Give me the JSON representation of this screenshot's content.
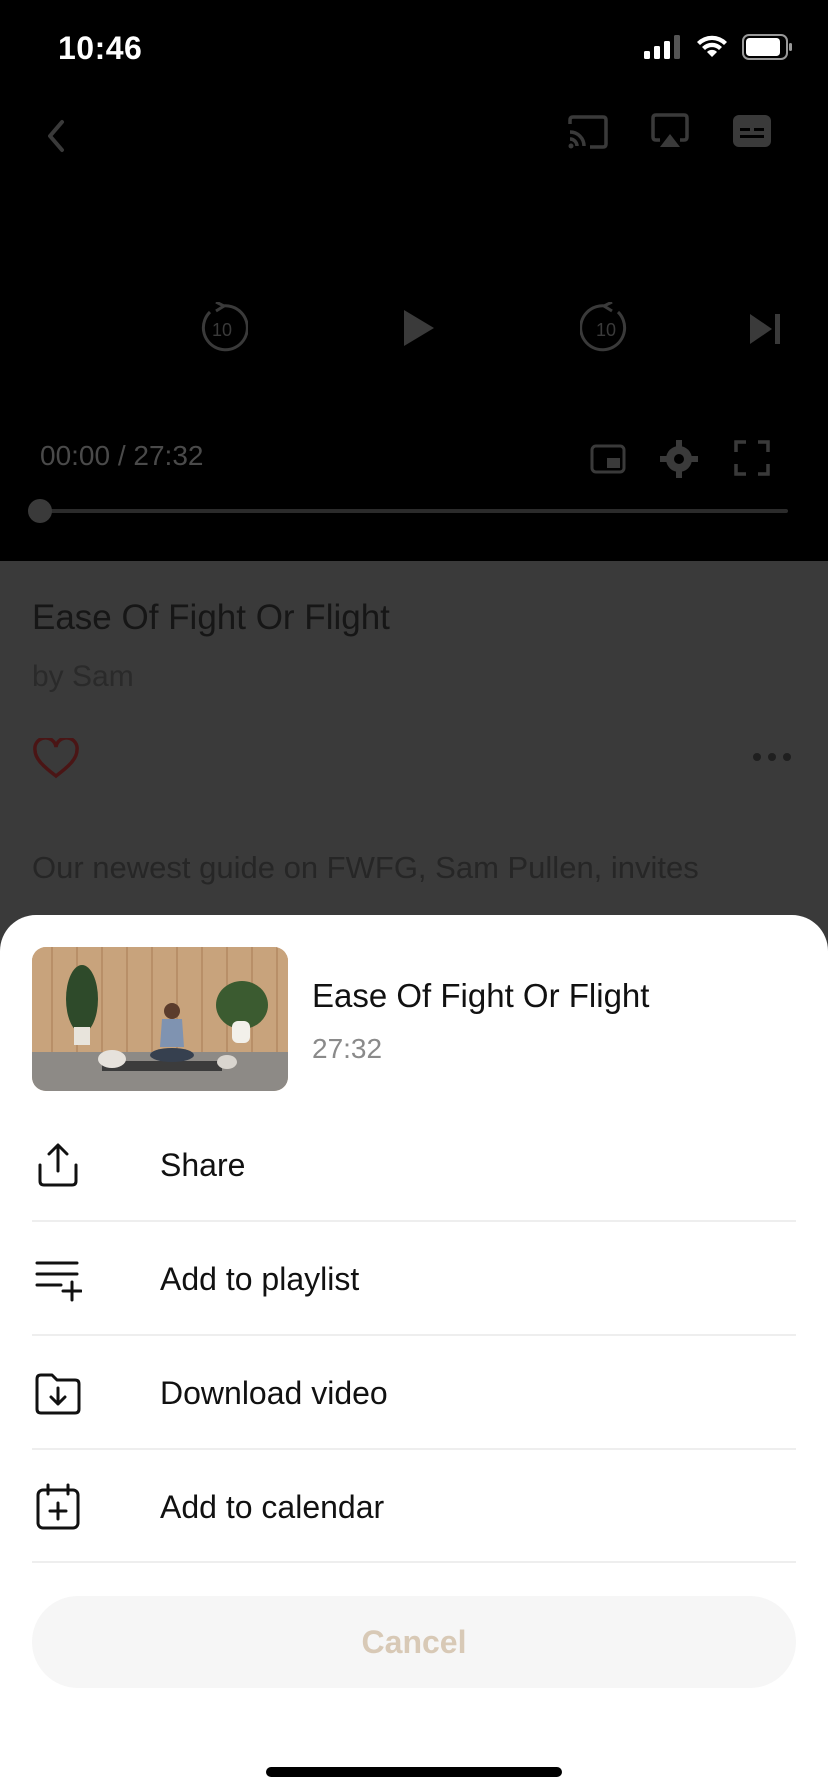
{
  "status_bar": {
    "time": "10:46"
  },
  "player": {
    "time_readout": "00:00 / 27:32",
    "progress": 0.0,
    "skip_back_label": "10",
    "skip_forward_label": "10"
  },
  "video": {
    "title": "Ease Of Fight Or Flight",
    "author": "by Sam",
    "description": "Our newest guide on FWFG, Sam Pullen, invites"
  },
  "sheet": {
    "title": "Ease Of Fight Or Flight",
    "duration": "27:32",
    "items": [
      {
        "label": "Share",
        "icon": "share-icon"
      },
      {
        "label": "Add to playlist",
        "icon": "playlist-add-icon"
      },
      {
        "label": "Download video",
        "icon": "download-folder-icon"
      },
      {
        "label": "Add to calendar",
        "icon": "calendar-add-icon"
      }
    ],
    "cancel_label": "Cancel"
  },
  "colors": {
    "cancel_text": "#d8c9b6",
    "sheet_bg": "#ffffff",
    "overlay": "#3a3a3a"
  }
}
